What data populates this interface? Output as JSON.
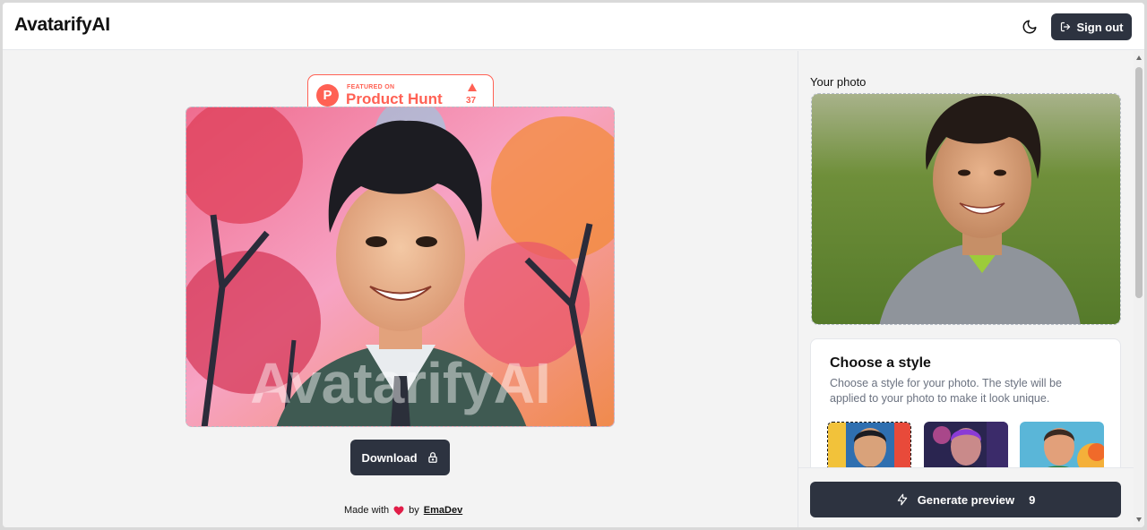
{
  "app": {
    "title": "AvatarifyAI"
  },
  "header": {
    "theme_icon": "moon-icon",
    "sign_out_label": "Sign out",
    "sign_out_icon": "sign-out-icon"
  },
  "product_hunt": {
    "featured_label": "FEATURED ON",
    "name": "Product Hunt",
    "logo_letter": "P",
    "upvotes": "37",
    "color": "#ff6154"
  },
  "result": {
    "watermark": "AvatarifyAI",
    "download_label": "Download",
    "download_icon": "lock-icon"
  },
  "footer": {
    "made_with": "Made with",
    "heart_icon": "heart-icon",
    "by": "by",
    "author": "EmaDev"
  },
  "panel": {
    "your_photo_label": "Your photo",
    "style_section": {
      "title": "Choose a style",
      "description": "Choose a style for your photo. The style will be applied to your photo to make it look unique.",
      "styles": [
        {
          "name": "style-comic",
          "selected": true
        },
        {
          "name": "style-neon",
          "selected": false
        },
        {
          "name": "style-fire",
          "selected": false
        }
      ]
    },
    "generate": {
      "label": "Generate preview",
      "count": "9",
      "icon": "lightning-icon"
    }
  },
  "colors": {
    "button_dark": "#2d3340",
    "accent": "#ff6154",
    "heart": "#e11d48"
  }
}
